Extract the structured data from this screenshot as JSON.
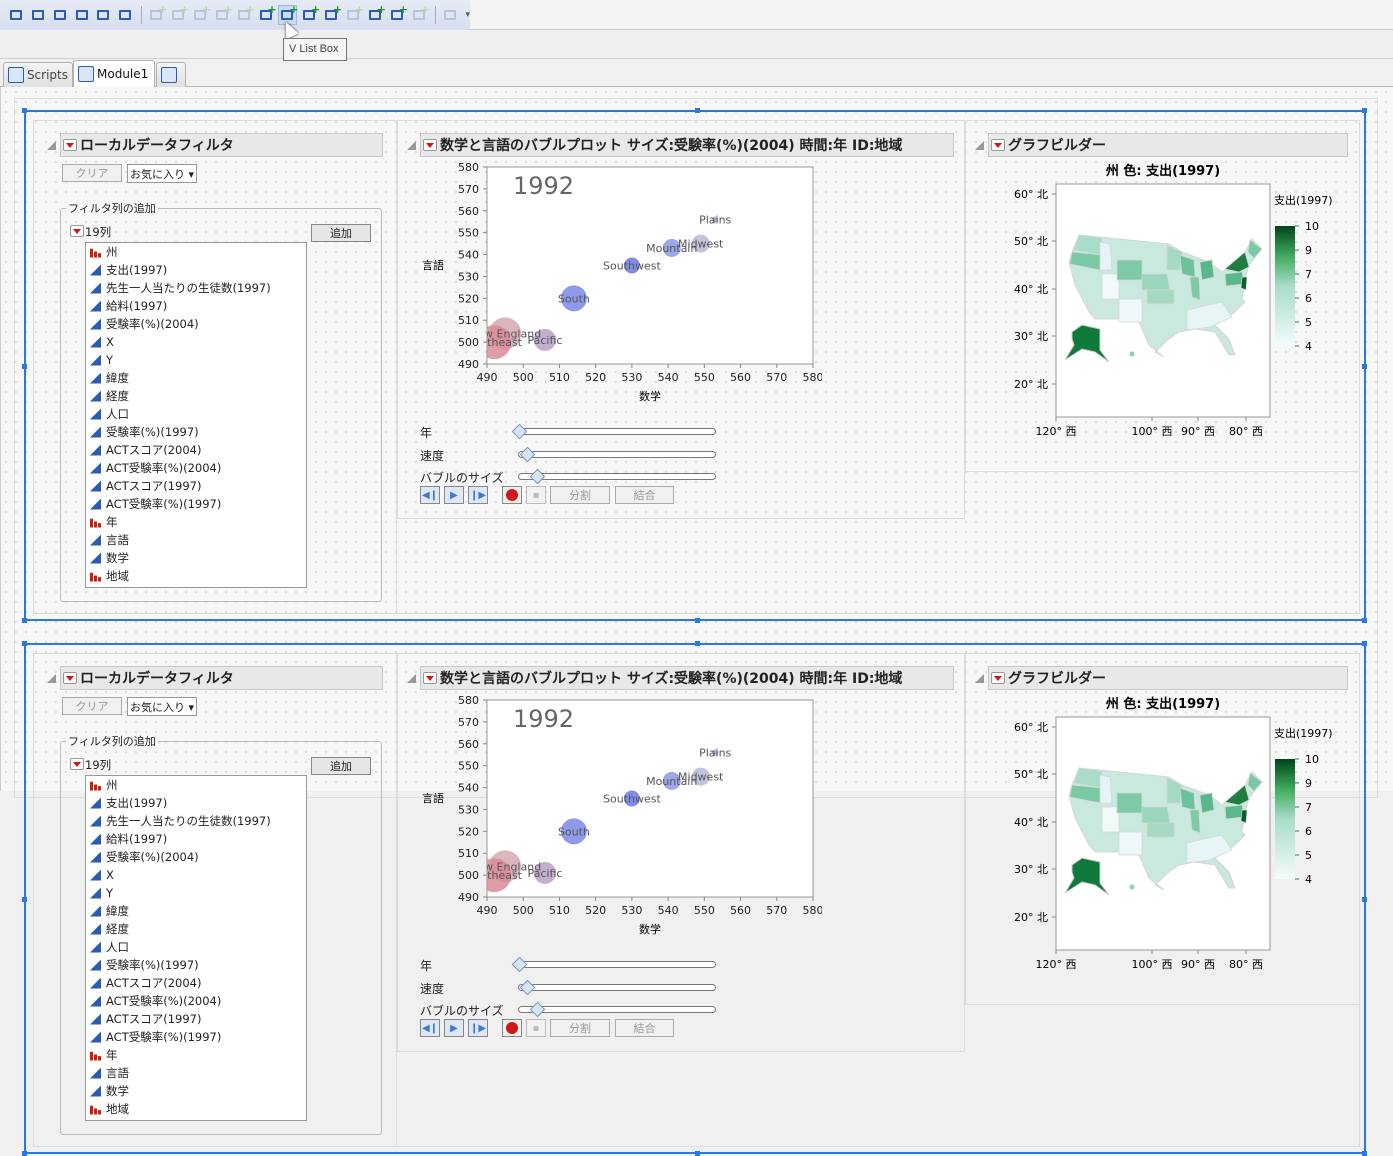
{
  "toolbar": {
    "icons": [
      {
        "name": "align-left-icon",
        "dim": false,
        "add": false
      },
      {
        "name": "align-center-icon",
        "dim": false,
        "add": false
      },
      {
        "name": "align-right-icon",
        "dim": false,
        "add": false
      },
      {
        "name": "align-top-icon",
        "dim": false,
        "add": false
      },
      {
        "name": "align-middle-icon",
        "dim": false,
        "add": false
      },
      {
        "name": "align-bottom-icon",
        "dim": false,
        "add": false
      },
      {
        "sep": true
      },
      {
        "name": "add-box-icon",
        "dim": true,
        "add": true
      },
      {
        "name": "add-tab-icon",
        "dim": true,
        "add": true
      },
      {
        "name": "add-lineup-icon",
        "dim": true,
        "add": true
      },
      {
        "name": "add-outline-icon",
        "dim": true,
        "add": true
      },
      {
        "name": "add-panel-icon",
        "dim": true,
        "add": true
      },
      {
        "name": "add-h-list-box-icon",
        "dim": false,
        "add": true
      },
      {
        "name": "add-v-list-box-icon",
        "dim": false,
        "add": true,
        "hover": true
      },
      {
        "name": "add-h-splitter-icon",
        "dim": false,
        "add": true
      },
      {
        "name": "add-v-splitter-icon",
        "dim": false,
        "add": true
      },
      {
        "name": "add-selection-icon",
        "dim": true,
        "add": true
      },
      {
        "name": "add-line-icon",
        "dim": false,
        "add": true
      },
      {
        "name": "add-border-box-icon",
        "dim": false,
        "add": true
      },
      {
        "name": "add-page-icon",
        "dim": true,
        "add": true
      },
      {
        "sep": true
      },
      {
        "name": "run-icon",
        "dim": true,
        "add": false
      }
    ],
    "tooltip": "V List Box"
  },
  "tabs": [
    {
      "label": "Scripts",
      "active": false
    },
    {
      "label": "Module1",
      "active": true
    },
    {
      "label": "",
      "active": false
    }
  ],
  "filter": {
    "title": "ローカルデータフィルタ",
    "clear_label": "クリア",
    "favorites_label": "お気に入り ▾",
    "group_label": "フィルタ列の追加",
    "column_count": "19列",
    "add_label": "追加",
    "columns": [
      {
        "label": "州",
        "type": "nominal"
      },
      {
        "label": "支出(1997)",
        "type": "continuous"
      },
      {
        "label": "先生一人当たりの生徒数(1997)",
        "type": "continuous"
      },
      {
        "label": "給料(1997)",
        "type": "continuous"
      },
      {
        "label": "受験率(%)(2004)",
        "type": "continuous"
      },
      {
        "label": "X",
        "type": "continuous"
      },
      {
        "label": "Y",
        "type": "continuous"
      },
      {
        "label": "緯度",
        "type": "continuous"
      },
      {
        "label": "経度",
        "type": "continuous"
      },
      {
        "label": "人口",
        "type": "continuous"
      },
      {
        "label": "受験率(%)(1997)",
        "type": "continuous"
      },
      {
        "label": "ACTスコア(2004)",
        "type": "continuous"
      },
      {
        "label": "ACT受験率(%)(2004)",
        "type": "continuous"
      },
      {
        "label": "ACTスコア(1997)",
        "type": "continuous"
      },
      {
        "label": "ACT受験率(%)(1997)",
        "type": "continuous"
      },
      {
        "label": "年",
        "type": "nominal"
      },
      {
        "label": "言語",
        "type": "continuous"
      },
      {
        "label": "数学",
        "type": "continuous"
      },
      {
        "label": "地域",
        "type": "nominal"
      }
    ]
  },
  "bubble": {
    "title": "数学と言語のバブルプロット サイズ:受験率(%)(2004) 時間:年 ID:地域",
    "sliders": [
      {
        "label": "年",
        "value": 0.0
      },
      {
        "label": "速度",
        "value": 0.04
      },
      {
        "label": "バブルのサイズ",
        "value": 0.09
      }
    ],
    "split_label": "分割",
    "combine_label": "結合"
  },
  "chart_data": {
    "type": "scatter",
    "title": "1992",
    "xlabel": "数学",
    "ylabel": "言語",
    "xlim": [
      490,
      580
    ],
    "ylim": [
      490,
      580
    ],
    "xticks": [
      490,
      500,
      510,
      520,
      530,
      540,
      550,
      560,
      570,
      580
    ],
    "yticks": [
      490,
      500,
      510,
      520,
      530,
      540,
      550,
      560,
      570,
      580
    ],
    "points": [
      {
        "label": "Plains",
        "x": 553,
        "y": 556,
        "size": 2,
        "color": "#9aa4e8"
      },
      {
        "label": "Midwest",
        "x": 549,
        "y": 545,
        "size": 8,
        "color": "#b8b8d8"
      },
      {
        "label": "Mountain",
        "x": 541,
        "y": 543,
        "size": 8,
        "color": "#8e98e6"
      },
      {
        "label": "Southwest",
        "x": 530,
        "y": 535,
        "size": 7,
        "color": "#6b78e6"
      },
      {
        "label": "South",
        "x": 514,
        "y": 520,
        "size": 12,
        "color": "#7d88e8"
      },
      {
        "label": "Pacific",
        "x": 506,
        "y": 501,
        "size": 10,
        "color": "#b8a0c4"
      },
      {
        "label": "New England",
        "x": 495,
        "y": 504,
        "size": 15,
        "color": "#d4aab4"
      },
      {
        "label": "Southeast",
        "x": 492,
        "y": 500,
        "size": 16,
        "color": "#d88c98"
      }
    ]
  },
  "map": {
    "title": "グラフビルダー",
    "chart_title": "州 色: 支出(1997)",
    "lat_ticks": [
      "60° 北",
      "50° 北",
      "40° 北",
      "30° 北",
      "20° 北"
    ],
    "lon_ticks": [
      "120° 西",
      "100° 西",
      "90° 西",
      "80° 西"
    ],
    "legend_title": "支出(1997)",
    "legend_ticks": [
      "10",
      "9",
      "7",
      "6",
      "5",
      "4"
    ],
    "color_low": "#f5fbfd",
    "color_high": "#00441b"
  }
}
